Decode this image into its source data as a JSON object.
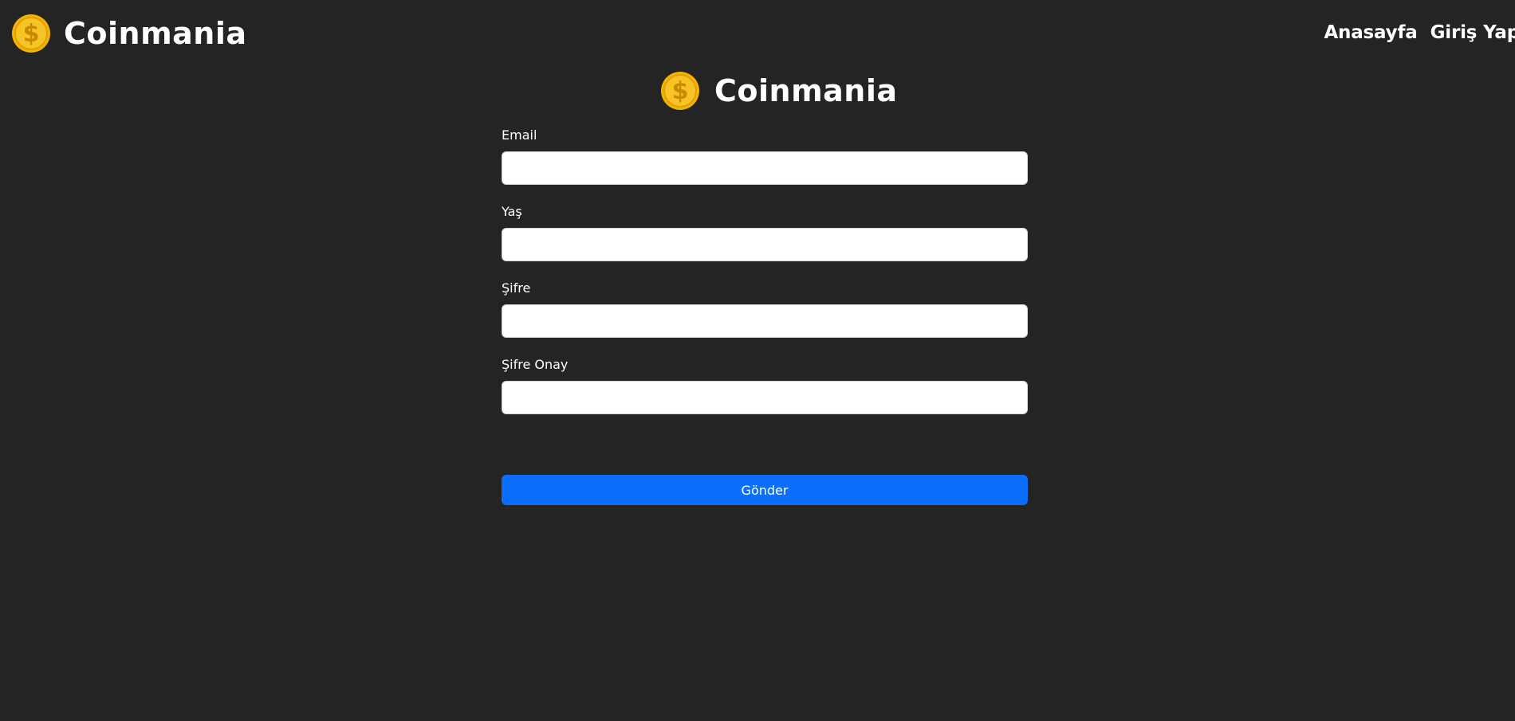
{
  "navbar": {
    "brand_text": "Coinmania",
    "brand_icon": "coin-dollar-icon",
    "links": [
      {
        "label": "Anasayfa"
      },
      {
        "label": "Giriş Yap"
      }
    ]
  },
  "form": {
    "brand_text": "Coinmania",
    "fields": [
      {
        "label": "Email",
        "value": "",
        "placeholder": ""
      },
      {
        "label": "Yaş",
        "value": "",
        "placeholder": ""
      },
      {
        "label": "Şifre",
        "value": "",
        "placeholder": ""
      },
      {
        "label": "Şifre Onay",
        "value": "",
        "placeholder": ""
      }
    ],
    "submit_label": "Gönder"
  },
  "colors": {
    "background": "#242424",
    "primary": "#0d6efd",
    "coin_gold": "#f4b400"
  }
}
